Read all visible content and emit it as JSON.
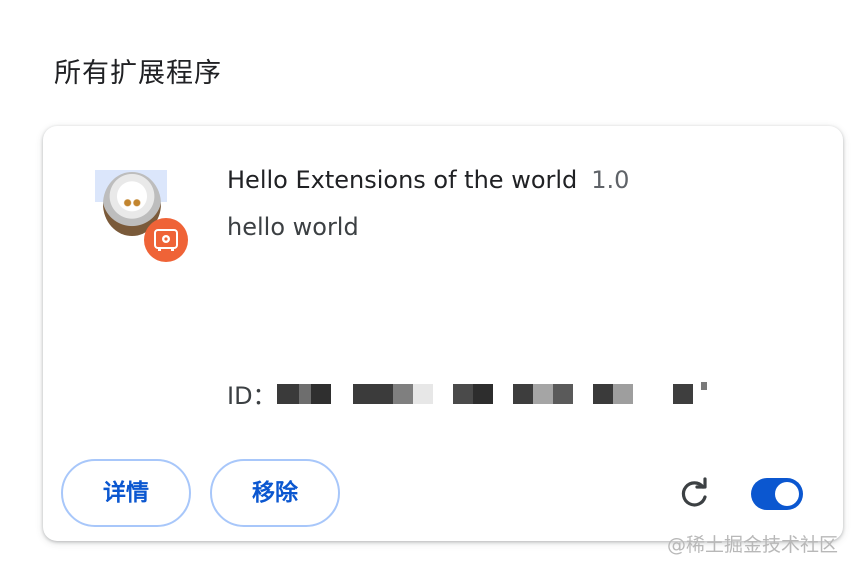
{
  "section": {
    "title": "所有扩展程序"
  },
  "extension": {
    "name": "Hello Extensions of the world",
    "version": "1.0",
    "description": "hello world",
    "id_label": "ID：",
    "enabled": true
  },
  "actions": {
    "details_label": "详情",
    "remove_label": "移除"
  },
  "icons": {
    "extension_icon": "anime-avatar-icon",
    "badge_icon": "unpacked-extension-badge-icon",
    "reload_icon": "reload-icon"
  },
  "colors": {
    "accent": "#0b57d0",
    "button_border": "#a8c7fa",
    "badge": "#ef6337"
  },
  "watermark": "@稀土掘金技术社区"
}
